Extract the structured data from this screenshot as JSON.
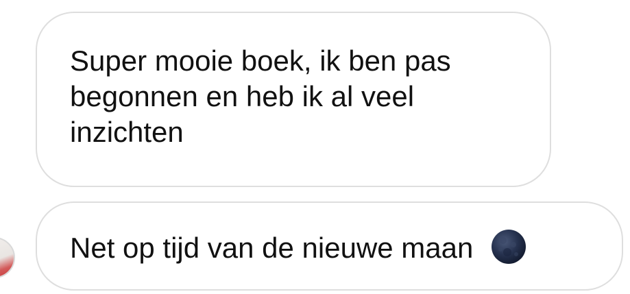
{
  "messages": [
    {
      "text": "Super mooie boek, ik ben pas begonnen en heb ik al veel inzichten",
      "emoji": ""
    },
    {
      "text": "Net op tijd van de nieuwe maan",
      "emoji": "new-moon-icon"
    }
  ],
  "colors": {
    "background": "#ffffff",
    "bubble_border": "#dedede",
    "text": "#111111",
    "moon_dark": "#1f2a44"
  }
}
